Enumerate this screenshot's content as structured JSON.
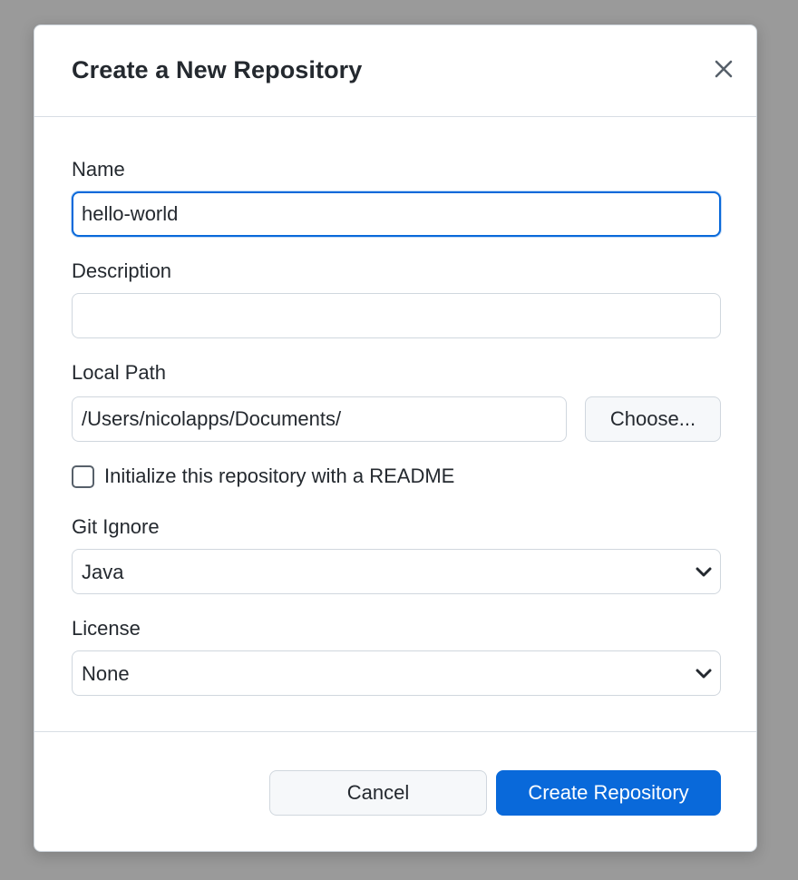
{
  "dialog": {
    "title": "Create a New Repository"
  },
  "fields": {
    "name": {
      "label": "Name",
      "value": "hello-world"
    },
    "description": {
      "label": "Description",
      "value": ""
    },
    "local_path": {
      "label": "Local Path",
      "value": "/Users/nicolapps/Documents/",
      "choose_label": "Choose..."
    },
    "readme": {
      "label": "Initialize this repository with a README",
      "checked": false
    },
    "git_ignore": {
      "label": "Git Ignore",
      "selected": "Java"
    },
    "license": {
      "label": "License",
      "selected": "None"
    }
  },
  "actions": {
    "cancel_label": "Cancel",
    "create_label": "Create Repository"
  },
  "icons": {
    "close": "close-icon",
    "chevron": "chevron-down-icon"
  },
  "colors": {
    "primary": "#0969da",
    "backdrop": "#9a9a9a",
    "text": "#24292f",
    "border": "#d0d7de"
  }
}
